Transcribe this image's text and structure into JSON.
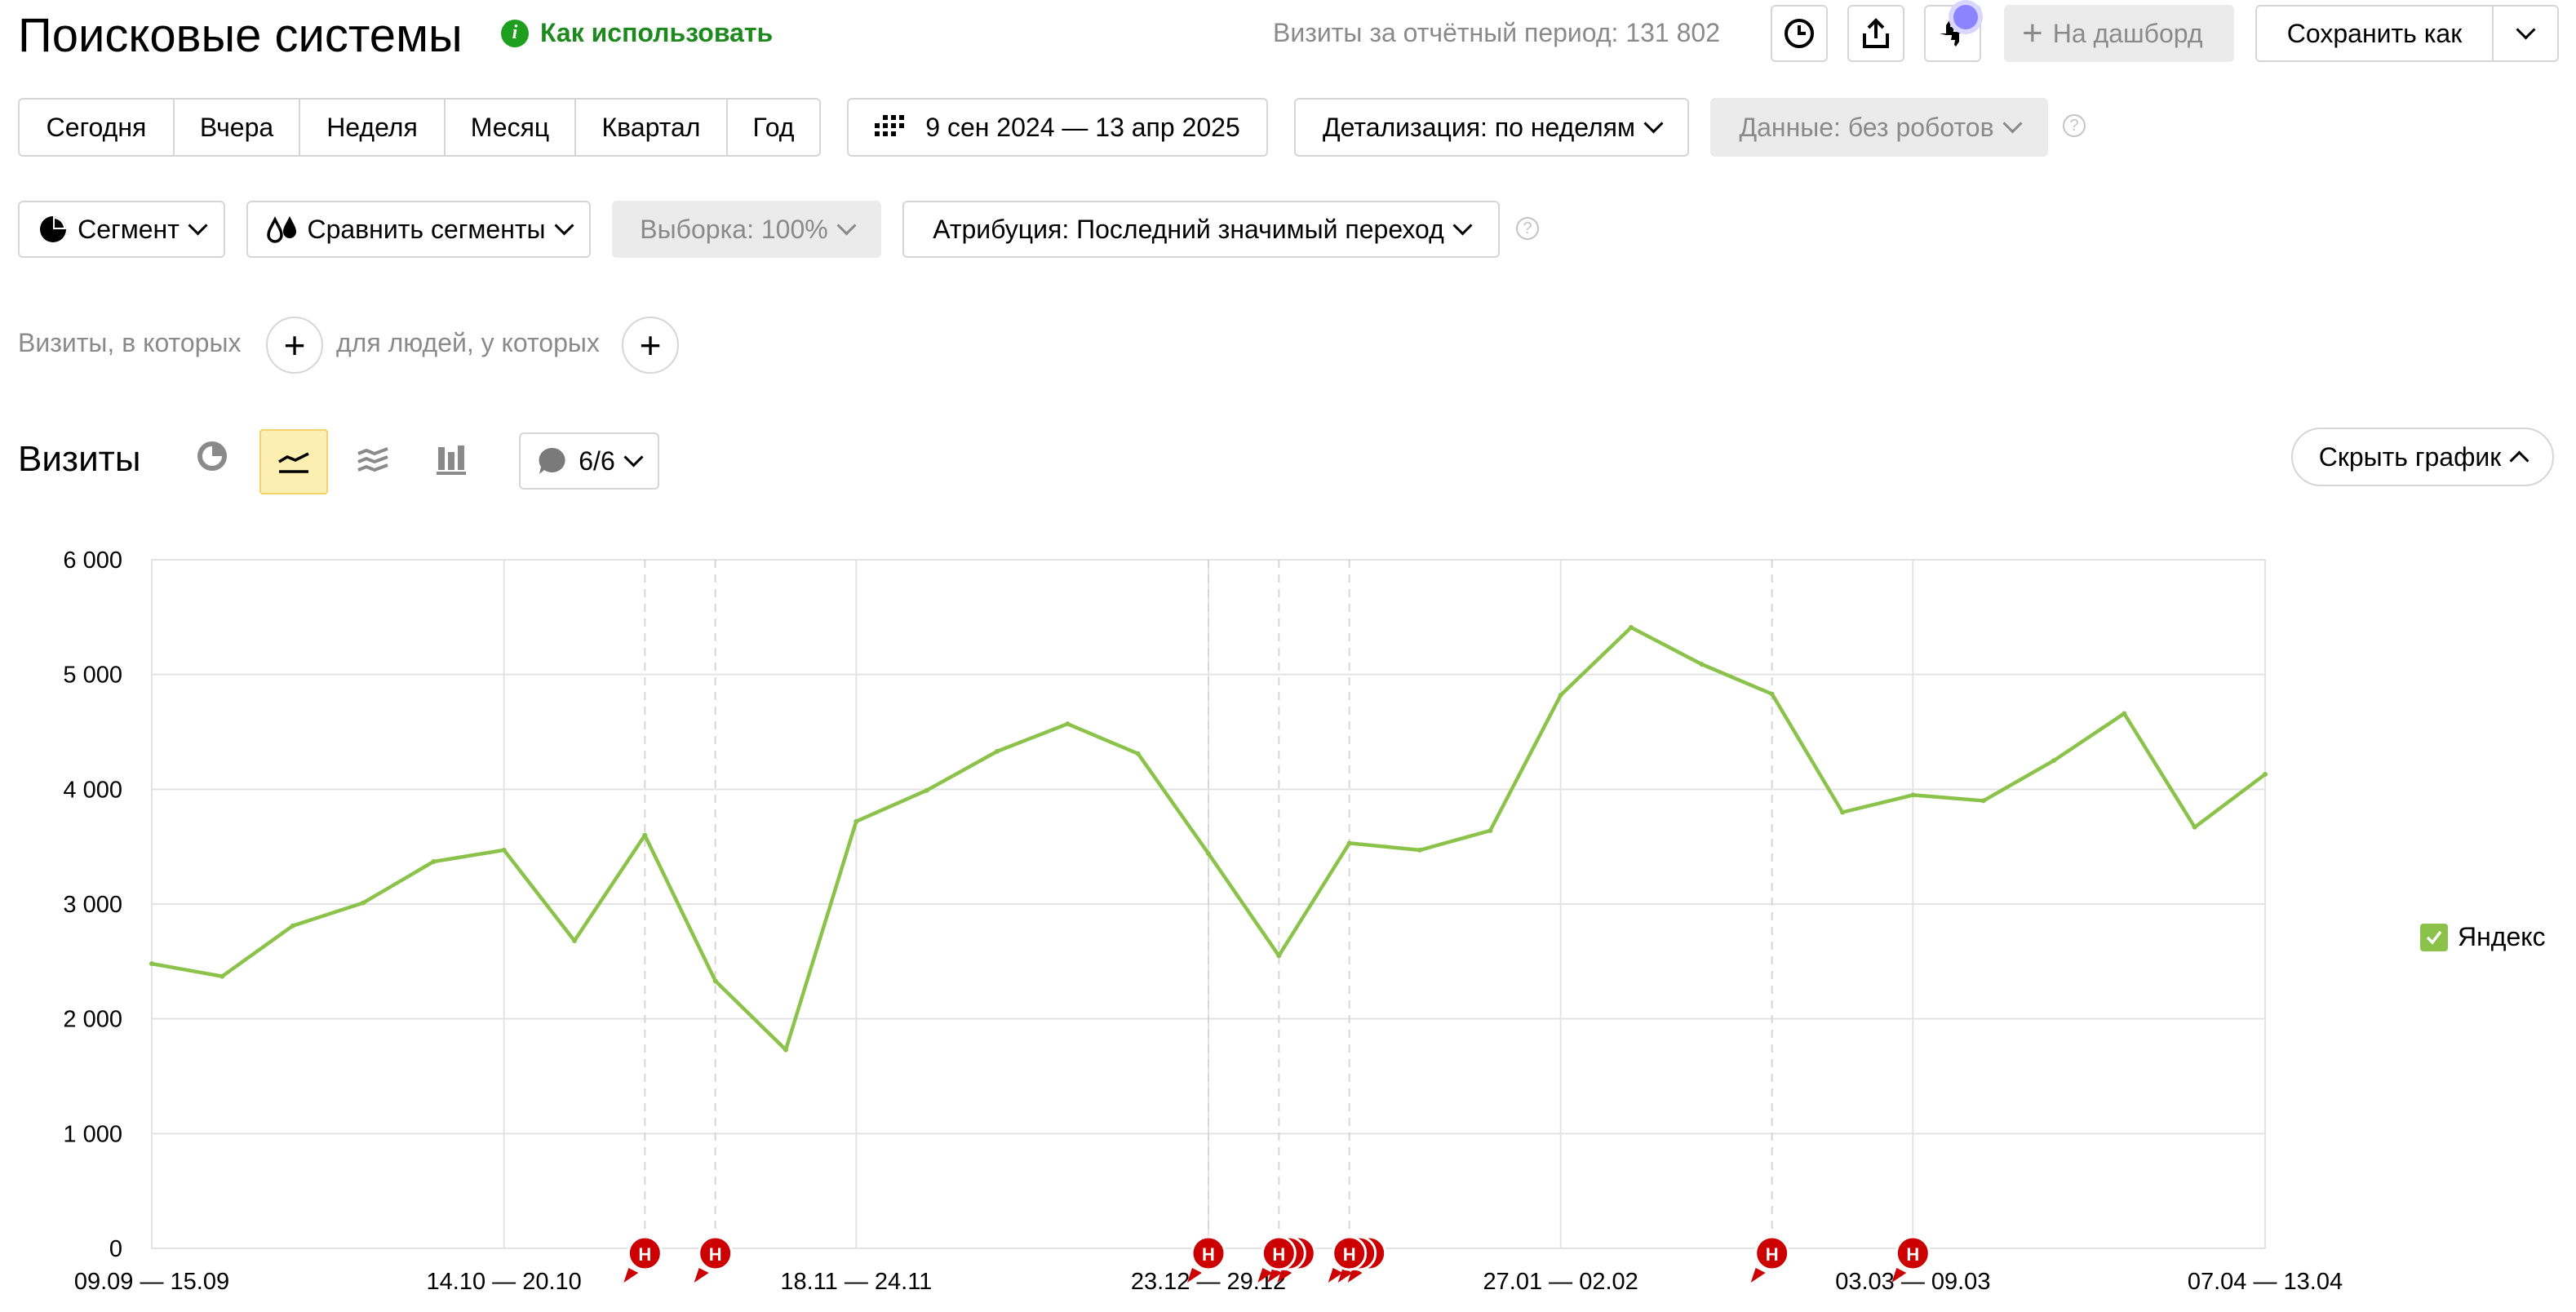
{
  "header": {
    "title": "Поисковые системы",
    "help_link": "Как использовать",
    "visits_summary": "Визиты за отчётный период: 131 802",
    "dashboard_button": "На дашборд",
    "save_as_button": "Сохранить как"
  },
  "period_buttons": [
    "Сегодня",
    "Вчера",
    "Неделя",
    "Месяц",
    "Квартал",
    "Год"
  ],
  "date_range": "9 сен 2024 — 13 апр 2025",
  "detail_select": "Детализация: по неделям",
  "data_select": "Данные: без роботов",
  "filters": {
    "segment": "Сегмент",
    "compare": "Сравнить сегменты",
    "sample": "Выборка: 100%",
    "attribution": "Атрибуция: Последний значимый переход"
  },
  "conditions": {
    "visits_label": "Визиты, в которых",
    "people_label": "для людей, у которых"
  },
  "chart_section": {
    "title": "Визиты",
    "notes_count": "6/6",
    "hide_button": "Скрыть график",
    "legend_label": "Яндекс",
    "colors": {
      "line": "#8bc34a",
      "note_marker": "#cc0000",
      "active_view": "#fdeeb2"
    }
  },
  "chart_data": {
    "type": "line",
    "series": [
      {
        "name": "Яндекс",
        "values": [
          2480,
          2370,
          2810,
          3010,
          3370,
          3470,
          2680,
          3600,
          2330,
          1730,
          3720,
          3990,
          4330,
          4570,
          4310,
          3440,
          2550,
          3530,
          3470,
          3640,
          4820,
          5410,
          5090,
          4830,
          3800,
          3950,
          3900,
          4250,
          4660,
          3670,
          4130
        ]
      }
    ],
    "x_tick_labels": [
      "09.09 — 15.09",
      "14.10 — 20.10",
      "18.11 — 24.11",
      "23.12 — 29.12",
      "27.01 — 02.02",
      "03.03 — 09.03",
      "07.04 — 13.04"
    ],
    "y_tick_labels": [
      "0",
      "1 000",
      "2 000",
      "3 000",
      "4 000",
      "5 000",
      "6 000"
    ],
    "ylim": [
      0,
      6000
    ],
    "grid": true,
    "legend": "right",
    "note_marker_label": "Н",
    "note_weeks": [
      7,
      8,
      15,
      16,
      17,
      23,
      25
    ]
  }
}
